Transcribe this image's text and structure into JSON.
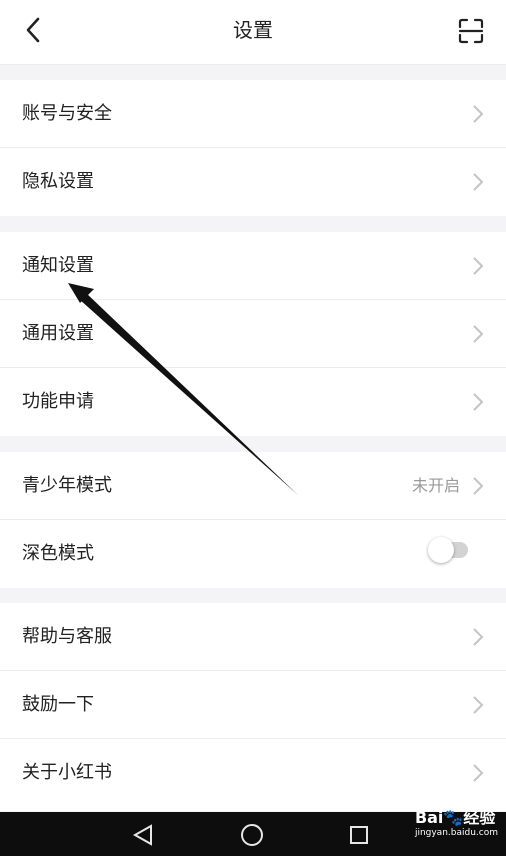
{
  "header": {
    "title": "设置",
    "back_icon": "chevron-left-icon",
    "scan_icon": "scan-icon"
  },
  "groups": [
    {
      "items": [
        {
          "label": "账号与安全"
        },
        {
          "label": "隐私设置"
        }
      ]
    },
    {
      "items": [
        {
          "label": "通知设置"
        },
        {
          "label": "通用设置"
        },
        {
          "label": "功能申请"
        }
      ]
    },
    {
      "items": [
        {
          "label": "青少年模式",
          "status": "未开启"
        },
        {
          "label": "深色模式",
          "toggle": false
        }
      ]
    },
    {
      "items": [
        {
          "label": "帮助与客服"
        },
        {
          "label": "鼓励一下"
        },
        {
          "label": "关于小红书"
        }
      ]
    }
  ],
  "navbar": {
    "back_icon": "triangle-back-icon",
    "home_icon": "circle-home-icon",
    "recents_icon": "square-recents-icon"
  },
  "watermark": {
    "brand": "Bai",
    "brand2": "经验",
    "url": "jingyan.baidu.com"
  },
  "colors": {
    "accent_chevron": "#c4c4c4",
    "status_text": "#9a9a9a",
    "toggle_off": "#d3d3d3"
  }
}
